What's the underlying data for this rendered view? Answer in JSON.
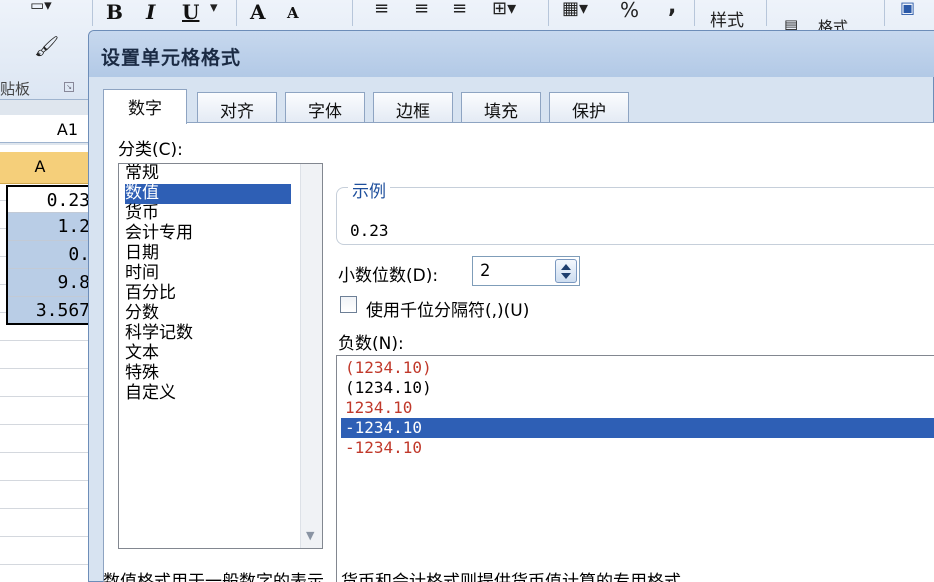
{
  "ribbon": {
    "bold": "B",
    "italic": "I",
    "underline": "U",
    "grow_font": "A",
    "shrink_font": "A",
    "percent": "%",
    "comma": ",",
    "styles": "样式",
    "format_fragment": "格式",
    "clipboard_group": "贴板"
  },
  "sheet": {
    "name_box": "A1",
    "column_header": "A",
    "cells": [
      "0.23",
      "1.2",
      "0.",
      "9.8",
      "3.567"
    ]
  },
  "dialog": {
    "title": "设置单元格格式",
    "tabs": [
      {
        "label": "数字",
        "active": true
      },
      {
        "label": "对齐",
        "active": false
      },
      {
        "label": "字体",
        "active": false
      },
      {
        "label": "边框",
        "active": false
      },
      {
        "label": "填充",
        "active": false
      },
      {
        "label": "保护",
        "active": false
      }
    ],
    "category_label": "分类(C):",
    "categories": [
      {
        "label": "常规",
        "selected": false
      },
      {
        "label": "数值",
        "selected": true
      },
      {
        "label": "货币",
        "selected": false
      },
      {
        "label": "会计专用",
        "selected": false
      },
      {
        "label": "日期",
        "selected": false
      },
      {
        "label": "时间",
        "selected": false
      },
      {
        "label": "百分比",
        "selected": false
      },
      {
        "label": "分数",
        "selected": false
      },
      {
        "label": "科学记数",
        "selected": false
      },
      {
        "label": "文本",
        "selected": false
      },
      {
        "label": "特殊",
        "selected": false
      },
      {
        "label": "自定义",
        "selected": false
      }
    ],
    "sample_label": "示例",
    "sample_value": "0.23",
    "decimal_places_label": "小数位数(D):",
    "decimal_places_value": "2",
    "thousands_separator_label": "使用千位分隔符(,)(U)",
    "thousands_separator_checked": false,
    "negative_numbers_label": "负数(N):",
    "negative_formats": [
      {
        "text": "(1234.10)",
        "color": "#c0392b",
        "selected": false
      },
      {
        "text": "(1234.10)",
        "color": "#000000",
        "selected": false
      },
      {
        "text": "1234.10",
        "color": "#c0392b",
        "selected": false
      },
      {
        "text": "-1234.10",
        "color": "#000000",
        "selected": true
      },
      {
        "text": "-1234.10",
        "color": "#c0392b",
        "selected": false
      }
    ],
    "description": "数值格式用于一般数字的表示。货币和会计格式则提供货币值计算的专用格式。"
  },
  "colors": {
    "selection": "#2e5fb5",
    "accent_text": "#1e4f9c",
    "negative_red": "#c0392b",
    "column_header": "#f5cf7a"
  }
}
